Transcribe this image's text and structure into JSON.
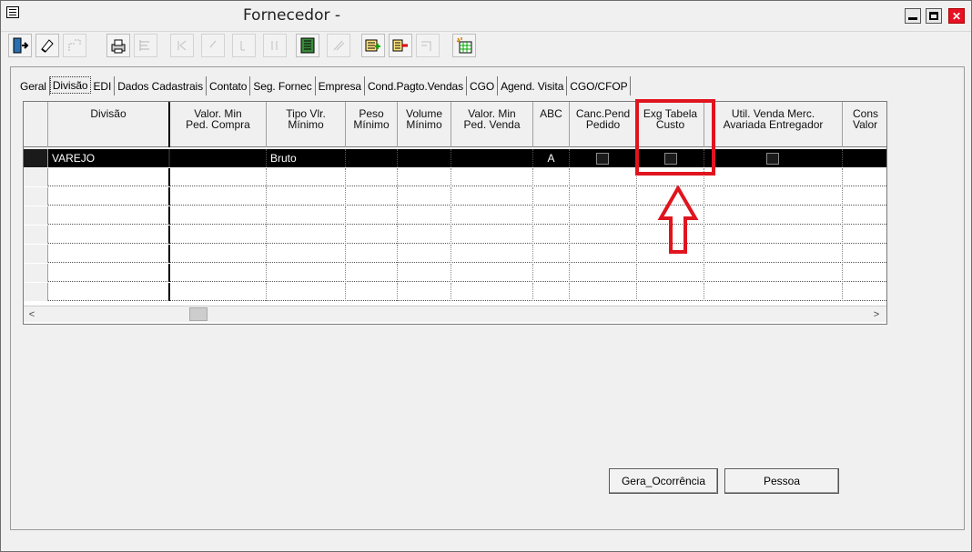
{
  "window": {
    "title": "Fornecedor -"
  },
  "toolbar": {
    "buttons": [
      {
        "icon": "exit-door-icon",
        "enabled": true
      },
      {
        "icon": "eraser-icon",
        "enabled": true
      },
      {
        "icon": "lookup-icon",
        "enabled": false
      },
      {
        "icon": "printer-icon",
        "enabled": true
      },
      {
        "icon": "list-icon",
        "enabled": false
      },
      {
        "icon": "first-record-icon",
        "enabled": false
      },
      {
        "icon": "previous-record-icon",
        "enabled": false
      },
      {
        "icon": "next-record-icon",
        "enabled": false
      },
      {
        "icon": "last-record-icon",
        "enabled": false
      },
      {
        "icon": "grid-view-icon",
        "enabled": true
      },
      {
        "icon": "edit-disabled-icon",
        "enabled": false
      },
      {
        "icon": "add-record-icon",
        "enabled": true
      },
      {
        "icon": "remove-record-icon",
        "enabled": true
      },
      {
        "icon": "move-record-icon",
        "enabled": false
      },
      {
        "icon": "new-table-icon",
        "enabled": true
      }
    ]
  },
  "tabs": [
    "Geral",
    "Divisão",
    "EDI",
    "Dados Cadastrais",
    "Contato",
    "Seg. Fornec",
    "Empresa",
    "Cond.Pagto.Vendas",
    "CGO",
    "Agend. Visita",
    "CGO/CFOP"
  ],
  "active_tab": "Divisão",
  "grid": {
    "columns": [
      {
        "line1": "Divisão",
        "line2": ""
      },
      {
        "line1": "Valor. Min",
        "line2": "Ped. Compra"
      },
      {
        "line1": "Tipo Vlr.",
        "line2": "Mínimo"
      },
      {
        "line1": "Peso",
        "line2": "Mínimo"
      },
      {
        "line1": "Volume",
        "line2": "Mínimo"
      },
      {
        "line1": "Valor. Min",
        "line2": "Ped. Venda"
      },
      {
        "line1": "ABC",
        "line2": ""
      },
      {
        "line1": "Canc.Pend",
        "line2": "Pedido"
      },
      {
        "line1": "Exg Tabela",
        "line2": "Custo"
      },
      {
        "line1": "Util. Venda Merc.",
        "line2": "Avariada Entregador"
      },
      {
        "line1": "Cons",
        "line2": "Valor"
      }
    ],
    "rows": [
      {
        "divisao": "VAREJO",
        "valor_min_ped_compra": "",
        "tipo_vlr_minimo": "Bruto",
        "peso_minimo": "",
        "volume_minimo": "",
        "valor_min_ped_venda": "",
        "abc": "A",
        "canc_pend_pedido": false,
        "exg_tabela_custo": false,
        "util_venda_merc": false,
        "cons_valor": ""
      }
    ],
    "empty_rows": 7
  },
  "buttons": {
    "gera_ocorrencia": "Gera_Ocorrência",
    "pessoa": "Pessoa"
  },
  "colors": {
    "highlight": "#e0141e",
    "selected_row": "#000000",
    "close_button": "#e81123"
  }
}
